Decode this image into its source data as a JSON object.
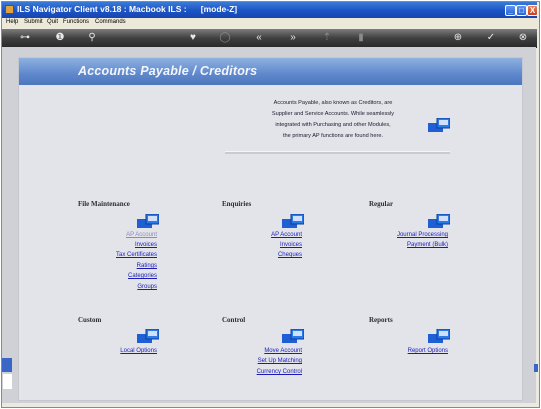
{
  "window": {
    "title": "ILS Navigator Client v8.18 : Macbook ILS :      [mode-Z]",
    "controls": [
      "_",
      "□",
      "X"
    ]
  },
  "menu": [
    "Help",
    "Submit",
    "Quit",
    "Functions",
    "Commands"
  ],
  "toolbar": {
    "icons": [
      "key-icon",
      "info-icon",
      "search-icon",
      "heart-icon",
      "refresh-icon",
      "rewind-icon",
      "fast-forward-icon",
      "upload-icon",
      "trash-icon",
      "plus-icon",
      "check-icon",
      "close-icon"
    ],
    "glyphs": [
      "⊶",
      "❶",
      "⚲",
      "♥",
      "◯",
      "«",
      "»",
      "⇡",
      "▮",
      "⊕",
      "✓",
      "⊗"
    ]
  },
  "banner": {
    "title": "Accounts Payable / Creditors"
  },
  "intro": {
    "lines": [
      "Accounts Payable, also known as Creditors, are",
      "Supplier and Service Accounts. While seamlessly",
      "integrated with Purchasing and other Modules,",
      "the primary AP functions are found here."
    ]
  },
  "sections": {
    "file_maintenance": {
      "title": "File Maintenance",
      "links": [
        "AP Account",
        "Invoices",
        "Tax Certificates",
        "Ratings",
        "Categories",
        "Groups"
      ]
    },
    "enquiries": {
      "title": "Enquiries",
      "links": [
        "AP Account",
        "Invoices",
        "Cheques"
      ]
    },
    "regular": {
      "title": "Regular",
      "links": [
        "Journal Processing",
        "Payment (Bulk)"
      ]
    },
    "custom": {
      "title": "Custom",
      "links": [
        "Local Options"
      ]
    },
    "control": {
      "title": "Control",
      "links": [
        "Move Account",
        "Set Up Matching",
        "Currency Control"
      ]
    },
    "reports": {
      "title": "Reports",
      "links": [
        "Report Options"
      ]
    }
  },
  "colors": {
    "titlebar": "#1c53c4",
    "banner": "#5f88cc",
    "link": "#1a1ab8",
    "panel": "#e2e4ea"
  }
}
